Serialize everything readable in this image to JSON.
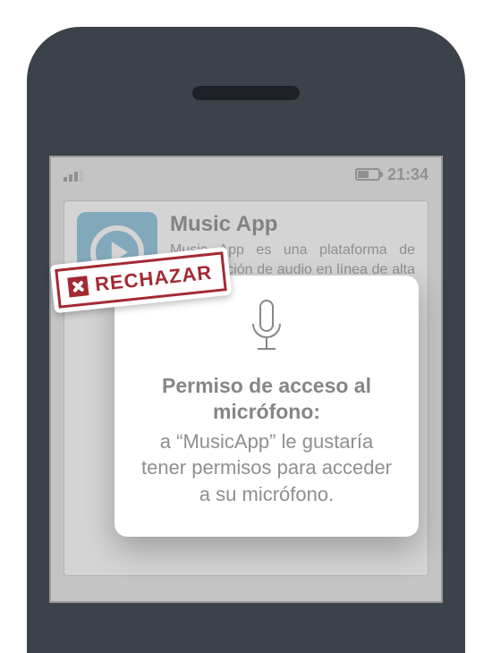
{
  "status_bar": {
    "time": "21:34"
  },
  "app_card": {
    "title": "Music App",
    "description": "Music App es una plataforma de reproducción de audio en línea de alta calidad. Descubre nueva música, crea tus propias listas y comparte tus canciones favoritas con tus amigos en cualquier momento."
  },
  "dialog": {
    "title": "Permiso de acceso al micrófono:",
    "body": "a “MusicApp” le gustaría tener permisos para acceder a su micrófono."
  },
  "stamp": {
    "label": "RECHAZAR"
  }
}
